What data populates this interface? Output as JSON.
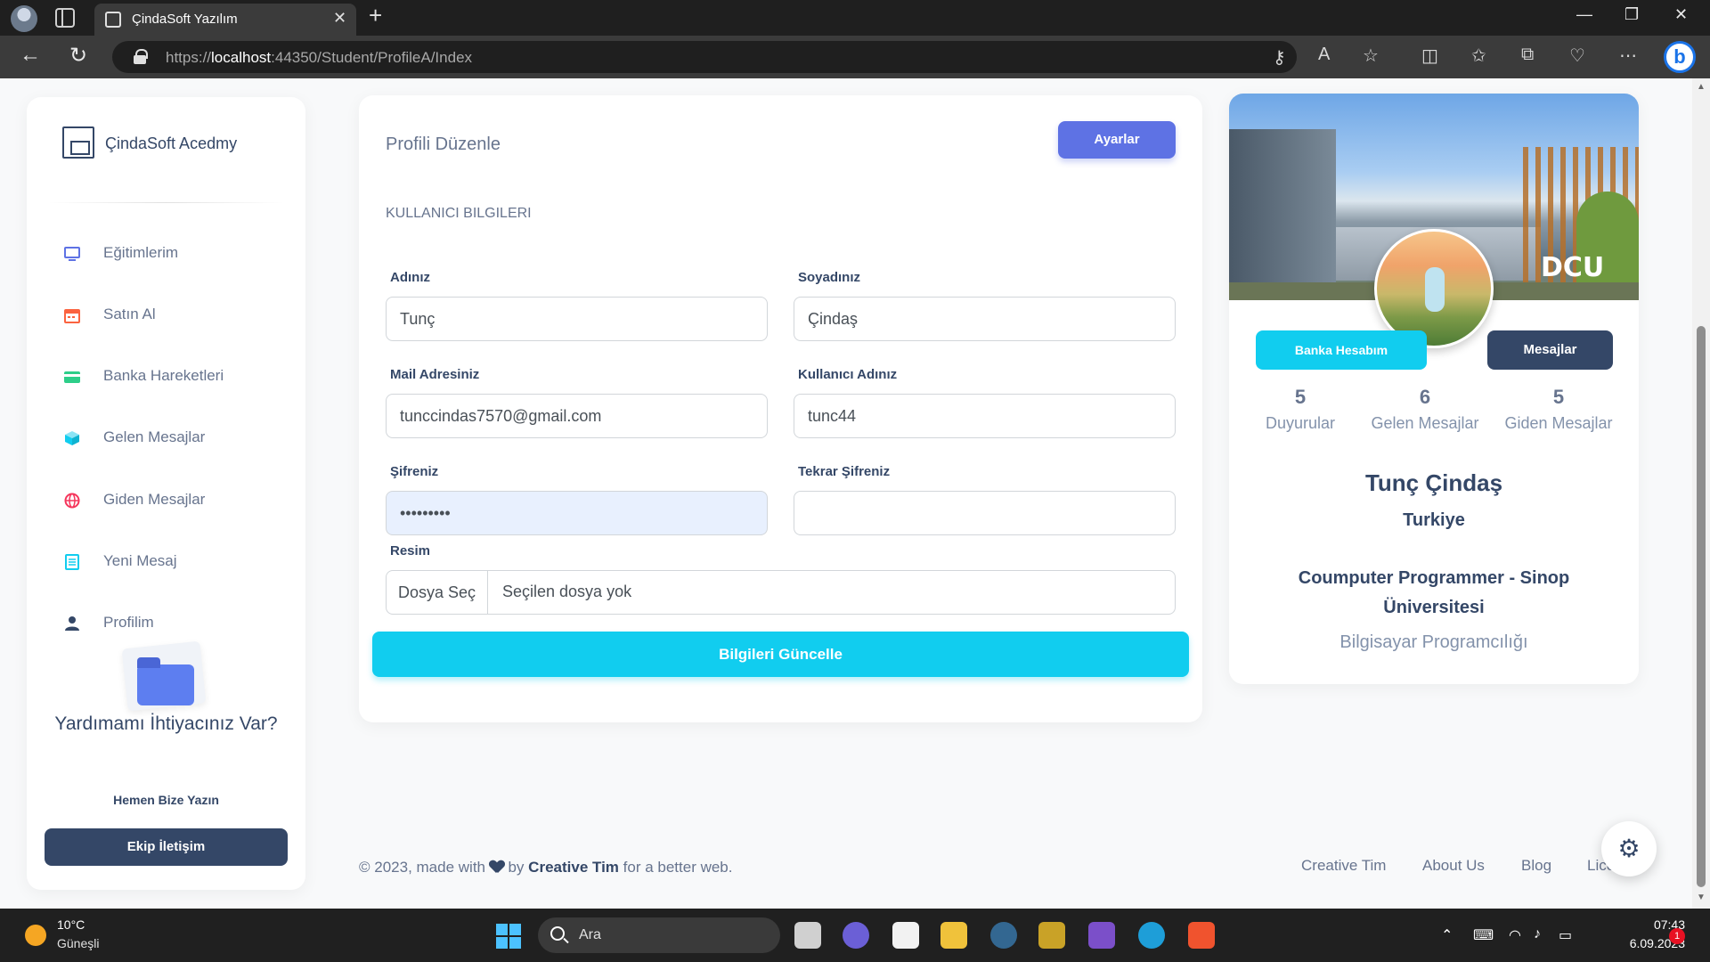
{
  "browser": {
    "tab_title": "ÇindaSoft Yazılım",
    "url_prefix": "https://",
    "url_host": "localhost",
    "url_rest": ":44350/Student/ProfileA/Index"
  },
  "sidebar": {
    "brand": "ÇindaSoft Acedmy",
    "items": [
      {
        "label": "Eğitimlerim",
        "icon": "monitor-icon",
        "color": "#5e72e4"
      },
      {
        "label": "Satın Al",
        "icon": "calendar-icon",
        "color": "#fb6340"
      },
      {
        "label": "Banka Hareketleri",
        "icon": "credit-card-icon",
        "color": "#2dce89"
      },
      {
        "label": "Gelen Mesajlar",
        "icon": "box-icon",
        "color": "#11cdef"
      },
      {
        "label": "Giden Mesajlar",
        "icon": "globe-icon",
        "color": "#f5365c"
      },
      {
        "label": "Yeni Mesaj",
        "icon": "document-icon",
        "color": "#11cdef"
      },
      {
        "label": "Profilim",
        "icon": "user-icon",
        "color": "#344767"
      }
    ],
    "help_title": "Yardımamı İhtiyacınız Var?",
    "help_sub": "Hemen Bize Yazın",
    "help_button": "Ekip İletişim"
  },
  "form": {
    "title": "Profili Düzenle",
    "settings_button": "Ayarlar",
    "section": "KULLANICI BILGILERI",
    "first_name_label": "Adınız",
    "first_name": "Tunç",
    "last_name_label": "Soyadınız",
    "last_name": "Çindaş",
    "email_label": "Mail Adresiniz",
    "email": "tunccindas7570@gmail.com",
    "username_label": "Kullanıcı Adınız",
    "username": "tunc44",
    "password_label": "Şifreniz",
    "password": "•••••••••",
    "password2_label": "Tekrar Şifreniz",
    "password2": "",
    "image_label": "Resim",
    "file_button": "Dosya Seç",
    "file_status": "Seçilen dosya yok",
    "submit": "Bilgileri Güncelle"
  },
  "profile": {
    "cover_logo": "DCU",
    "bank_button": "Banka Hesabım",
    "messages_button": "Mesajlar",
    "stats": [
      {
        "value": "5",
        "label": "Duyurular"
      },
      {
        "value": "6",
        "label": "Gelen Mesajlar"
      },
      {
        "value": "5",
        "label": "Giden Mesajlar"
      }
    ],
    "name": "Tunç Çindaş",
    "country": "Turkiye",
    "job": "Coumputer Programmer - Sinop Üniversitesi",
    "department": "Bilgisayar Programcılığı"
  },
  "footer": {
    "prefix": "© 2023, made with",
    "by": "by",
    "author": "Creative Tim",
    "suffix": "for a better web.",
    "links": [
      "Creative Tim",
      "About Us",
      "Blog",
      "Lice"
    ]
  },
  "taskbar": {
    "temp": "10°C",
    "weather": "Güneşli",
    "search_placeholder": "Ara",
    "time": "07:43",
    "date": "6.09.2023",
    "notifications": "1"
  }
}
